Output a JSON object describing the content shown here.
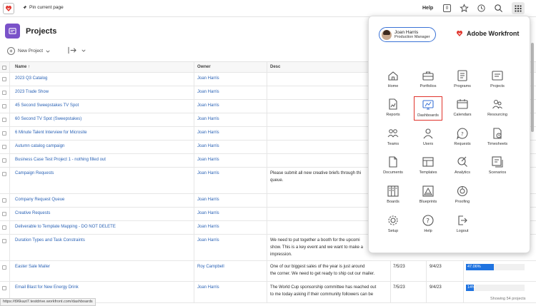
{
  "topbar": {
    "pin_label": "Pin current page",
    "help_label": "Help",
    "notification_count": "0"
  },
  "page": {
    "title": "Projects",
    "new_project_label": "New Project"
  },
  "table": {
    "headers": {
      "name": "Name",
      "owner": "Owner",
      "desc": "Desc"
    },
    "rows": [
      {
        "name": "2023 Q3 Catalog",
        "owner": "Joan Harris",
        "desc": ""
      },
      {
        "name": "2023 Trade Show",
        "owner": "Joan Harris",
        "desc": ""
      },
      {
        "name": "45 Second Sweepstakes TV Spot",
        "owner": "Joan Harris",
        "desc": ""
      },
      {
        "name": "60 Second TV Spot (Sweepstakes)",
        "owner": "Joan Harris",
        "desc": ""
      },
      {
        "name": "6 Minute Talent Interview for Microsite",
        "owner": "Joan Harris",
        "desc": ""
      },
      {
        "name": "Autumn catalog campaign",
        "owner": "Joan Harris",
        "desc": ""
      },
      {
        "name": "Business Case Test Project 1 - nothing filled out",
        "owner": "Joan Harris",
        "desc": ""
      },
      {
        "name": "Campaign Requests",
        "owner": "Joan Harris",
        "desc_l1": "Please submit all new creative briefs through thi",
        "desc_l2": "queue."
      },
      {
        "name": "Company Request Queue",
        "owner": "Joan Harris",
        "desc": ""
      },
      {
        "name": "Creative Requests",
        "owner": "Joan Harris",
        "desc": ""
      },
      {
        "name": "Deliverable to Template Mapping - DO NOT DELETE",
        "owner": "Joan Harris",
        "desc": ""
      },
      {
        "name": "Duration Types and Task Constraints",
        "owner": "Joan Harris",
        "desc_l1": "We need to put together a booth for the upcomi",
        "desc_l2": "show. This is a key event and we want to make a",
        "desc_l3": "impression."
      },
      {
        "name": "Easter Sale Mailer",
        "owner": "Roy Campbell",
        "desc_l1": "One of our biggest sales of the year is just around",
        "desc_l2": "the corner. We need to get ready to ship out our mailer.",
        "start": "7/5/23",
        "end": "9/4/23",
        "progress": "47.06%",
        "progress_value": 47.06
      },
      {
        "name": "Email Blast for New Energy Drink",
        "owner": "Joan Harris",
        "desc_l1": "The World Cup sponsorship committee has reached out",
        "desc_l2": "to me today asking if their community followers can be",
        "start": "7/5/23",
        "end": "9/4/23",
        "progress": "14%",
        "progress_value": 14
      }
    ]
  },
  "statusbar": {
    "url": "https://t96kazi7.testdrive.workfront.com/dashboards",
    "showing": "Showing 54 projects"
  },
  "panel": {
    "user_name": "Joan Harris",
    "user_role": "Production Manager",
    "brand": "Adobe Workfront",
    "apps": [
      {
        "label": "Home",
        "icon": "home-icon"
      },
      {
        "label": "Portfolios",
        "icon": "portfolio-icon"
      },
      {
        "label": "Programs",
        "icon": "programs-icon"
      },
      {
        "label": "Projects",
        "icon": "projects-icon"
      },
      {
        "label": "Reports",
        "icon": "reports-icon"
      },
      {
        "label": "Dashboards",
        "icon": "dashboards-icon"
      },
      {
        "label": "Calendars",
        "icon": "calendar-icon"
      },
      {
        "label": "Resourcing",
        "icon": "resourcing-icon"
      },
      {
        "label": "Teams",
        "icon": "teams-icon"
      },
      {
        "label": "Users",
        "icon": "user-icon"
      },
      {
        "label": "Requests",
        "icon": "requests-icon"
      },
      {
        "label": "Timesheets",
        "icon": "timesheet-icon"
      },
      {
        "label": "Documents",
        "icon": "document-icon"
      },
      {
        "label": "Templates",
        "icon": "template-icon"
      },
      {
        "label": "Analytics",
        "icon": "analytics-icon"
      },
      {
        "label": "Scenarios",
        "icon": "scenarios-icon"
      },
      {
        "label": "Boards",
        "icon": "boards-icon"
      },
      {
        "label": "Blueprints",
        "icon": "blueprints-icon"
      },
      {
        "label": "Proofing",
        "icon": "proofing-icon"
      },
      {
        "label": "Setup",
        "icon": "gear-icon"
      },
      {
        "label": "Help",
        "icon": "help-icon"
      },
      {
        "label": "Logout",
        "icon": "logout-icon"
      }
    ],
    "selected_app": "Dashboards"
  },
  "colors": {
    "accent": "#7a52c9",
    "link": "#2b63b6",
    "progress": "#1f73e0",
    "selected_border": "#e0332b",
    "brand_red": "#e0332b"
  }
}
